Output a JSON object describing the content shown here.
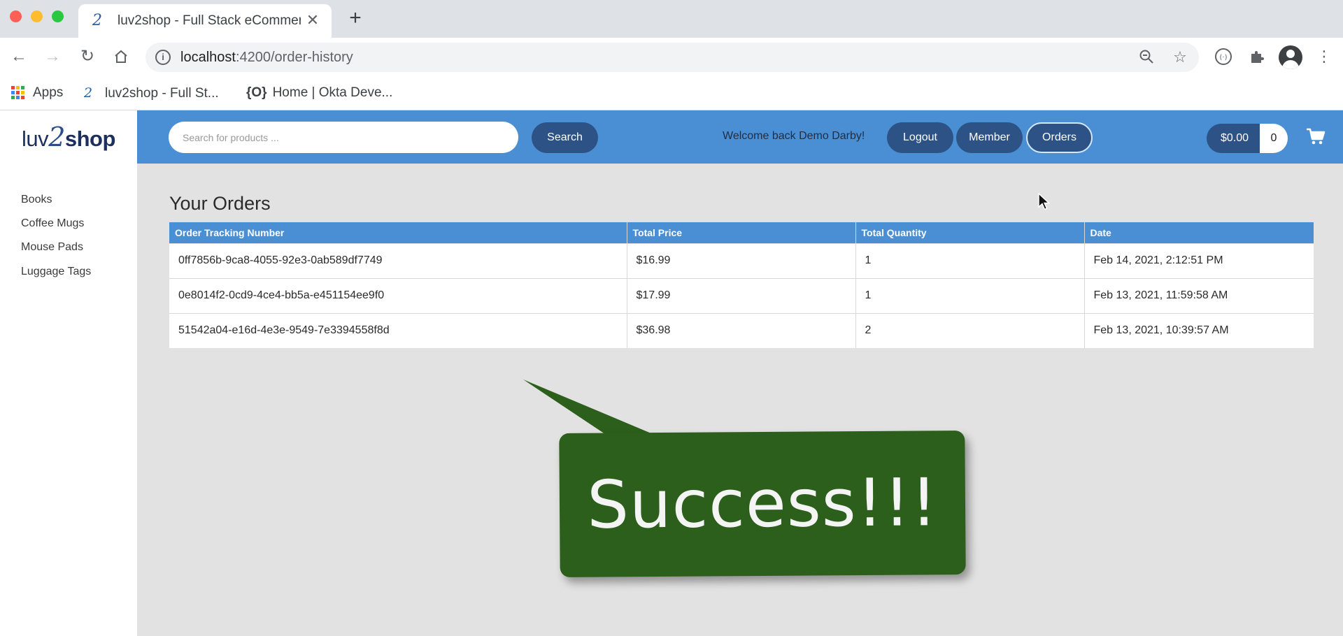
{
  "browser": {
    "tab_title": "luv2shop - Full Stack eCommerce",
    "url_host": "localhost",
    "url_rest": ":4200/order-history",
    "bookmarks": [
      {
        "label": "Apps"
      },
      {
        "label": "luv2shop - Full St..."
      },
      {
        "label": "Home | Okta Deve..."
      }
    ]
  },
  "app": {
    "logo": {
      "part1": "luv",
      "part2": "2",
      "part3": "shop"
    },
    "categories": [
      "Books",
      "Coffee Mugs",
      "Mouse Pads",
      "Luggage Tags"
    ],
    "search": {
      "placeholder": "Search for products ...",
      "button_label": "Search"
    },
    "welcome_text": "Welcome back Demo Darby!",
    "nav": {
      "logout": "Logout",
      "member": "Member",
      "orders": "Orders"
    },
    "cart": {
      "total": "$0.00",
      "quantity": "0"
    },
    "accent_color": "#4a8fd4",
    "button_color": "#2c5286"
  },
  "orders": {
    "title": "Your Orders",
    "columns": [
      "Order Tracking Number",
      "Total Price",
      "Total Quantity",
      "Date"
    ],
    "rows": [
      [
        "0ff7856b-9ca8-4055-92e3-0ab589df7749",
        "$16.99",
        "1",
        "Feb 14, 2021, 2:12:51 PM"
      ],
      [
        "0e8014f2-0cd9-4ce4-bb5a-e451154ee9f0",
        "$17.99",
        "1",
        "Feb 13, 2021, 11:59:58 AM"
      ],
      [
        "51542a04-e16d-4e3e-9549-7e3394558f8d",
        "$36.98",
        "2",
        "Feb 13, 2021, 10:39:57 AM"
      ]
    ]
  },
  "overlay": {
    "text": "Success!!!",
    "color": "#2d5f1c"
  }
}
